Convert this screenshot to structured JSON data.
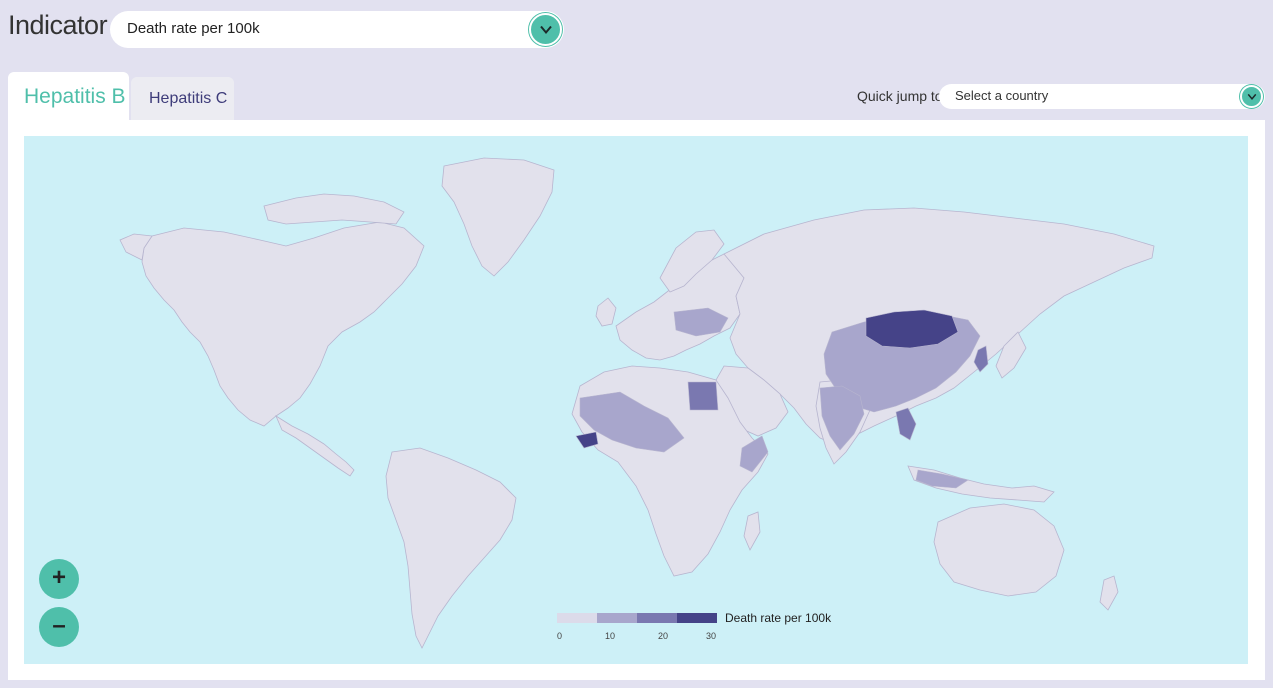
{
  "header": {
    "indicator_label": "Indicator",
    "indicator_value": "Death rate per 100k"
  },
  "tabs": [
    {
      "label": "Hepatitis B",
      "active": true
    },
    {
      "label": "Hepatitis C",
      "active": false
    }
  ],
  "quick_jump": {
    "label": "Quick jump to",
    "placeholder": "Select a country"
  },
  "legend": {
    "title": "Death rate per 100k",
    "ticks": [
      "0",
      "10",
      "20",
      "30"
    ],
    "colors": [
      "#dcdbea",
      "#a8a6cc",
      "#7a78b0",
      "#454388"
    ]
  },
  "zoom": {
    "in_label": "+",
    "out_label": "–"
  },
  "colors": {
    "accent": "#4fbfaa",
    "ocean": "#cdf0f7",
    "land": "#e2e1ec",
    "background": "#e2e1f0"
  },
  "map_highlights": [
    {
      "country": "Mongolia",
      "bin": 3
    },
    {
      "country": "Egypt",
      "bin": 2
    },
    {
      "country": "China",
      "bin": 1
    },
    {
      "country": "Thailand",
      "bin": 2
    },
    {
      "country": "Guinea",
      "bin": 3
    },
    {
      "country": "South Korea",
      "bin": 2
    },
    {
      "country": "India",
      "bin": 1
    },
    {
      "country": "Ukraine",
      "bin": 1
    },
    {
      "country": "Somalia",
      "bin": 1
    }
  ]
}
